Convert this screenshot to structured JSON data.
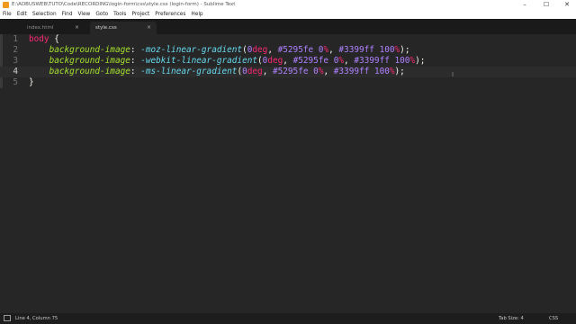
{
  "window": {
    "title": "E:\\ADBUSWEB\\TUTO\\Code\\RECORDING\\login-form\\css\\style.css (login-form) - Sublime Text",
    "icons": [
      "app-icon",
      "minimize-icon",
      "maximize-icon",
      "close-icon"
    ]
  },
  "menu": [
    "File",
    "Edit",
    "Selection",
    "Find",
    "View",
    "Goto",
    "Tools",
    "Project",
    "Preferences",
    "Help"
  ],
  "tabs": [
    {
      "label": "index.html",
      "close": "×",
      "active": false
    },
    {
      "label": "style.css",
      "close": "×",
      "active": true
    }
  ],
  "editor": {
    "line_numbers": [
      "1",
      "2",
      "3",
      "4",
      "5"
    ],
    "current_line": 4,
    "lines": [
      [
        {
          "t": "body",
          "c": "sel"
        },
        {
          "t": " {",
          "c": "pl"
        }
      ],
      [
        {
          "t": "    ",
          "c": "pl"
        },
        {
          "t": "background-image",
          "c": "prop"
        },
        {
          "t": ": ",
          "c": "pl"
        },
        {
          "t": "-moz-linear-gradient",
          "c": "fn"
        },
        {
          "t": "(",
          "c": "pl"
        },
        {
          "t": "0",
          "c": "num"
        },
        {
          "t": "deg",
          "c": "kw"
        },
        {
          "t": ", ",
          "c": "pl"
        },
        {
          "t": "#5295fe",
          "c": "num"
        },
        {
          "t": " ",
          "c": "pl"
        },
        {
          "t": "0",
          "c": "num"
        },
        {
          "t": "%",
          "c": "kw"
        },
        {
          "t": ", ",
          "c": "pl"
        },
        {
          "t": "#3399ff",
          "c": "num"
        },
        {
          "t": " ",
          "c": "pl"
        },
        {
          "t": "100",
          "c": "num"
        },
        {
          "t": "%",
          "c": "kw"
        },
        {
          "t": ");",
          "c": "pl"
        }
      ],
      [
        {
          "t": "    ",
          "c": "pl"
        },
        {
          "t": "background-image",
          "c": "prop"
        },
        {
          "t": ": ",
          "c": "pl"
        },
        {
          "t": "-webkit-linear-gradient",
          "c": "fn"
        },
        {
          "t": "(",
          "c": "pl"
        },
        {
          "t": "0",
          "c": "num"
        },
        {
          "t": "deg",
          "c": "kw"
        },
        {
          "t": ", ",
          "c": "pl"
        },
        {
          "t": "#5295fe",
          "c": "num"
        },
        {
          "t": " ",
          "c": "pl"
        },
        {
          "t": "0",
          "c": "num"
        },
        {
          "t": "%",
          "c": "kw"
        },
        {
          "t": ", ",
          "c": "pl"
        },
        {
          "t": "#3399ff",
          "c": "num"
        },
        {
          "t": " ",
          "c": "pl"
        },
        {
          "t": "100",
          "c": "num"
        },
        {
          "t": "%",
          "c": "kw"
        },
        {
          "t": ");",
          "c": "pl"
        }
      ],
      [
        {
          "t": "    ",
          "c": "pl"
        },
        {
          "t": "background-image",
          "c": "prop"
        },
        {
          "t": ": ",
          "c": "pl"
        },
        {
          "t": "-ms-linear-gradient",
          "c": "fn"
        },
        {
          "t": "(",
          "c": "pl"
        },
        {
          "t": "0",
          "c": "num"
        },
        {
          "t": "deg",
          "c": "kw"
        },
        {
          "t": ", ",
          "c": "pl"
        },
        {
          "t": "#5295fe",
          "c": "num"
        },
        {
          "t": " ",
          "c": "pl"
        },
        {
          "t": "0",
          "c": "num"
        },
        {
          "t": "%",
          "c": "kw"
        },
        {
          "t": ", ",
          "c": "pl"
        },
        {
          "t": "#3399ff",
          "c": "num"
        },
        {
          "t": " ",
          "c": "pl"
        },
        {
          "t": "100",
          "c": "num"
        },
        {
          "t": "%",
          "c": "kw"
        },
        {
          "t": ");",
          "c": "pl"
        }
      ],
      [
        {
          "t": "}",
          "c": "pl"
        }
      ]
    ]
  },
  "status": {
    "position": "Line 4, Column 75",
    "tab_size": "Tab Size: 4",
    "syntax": "CSS"
  },
  "colors": {
    "background": "#262626",
    "selector": "#f92672",
    "property": "#a6e22e",
    "function": "#66d9ef",
    "number": "#ae81ff"
  }
}
